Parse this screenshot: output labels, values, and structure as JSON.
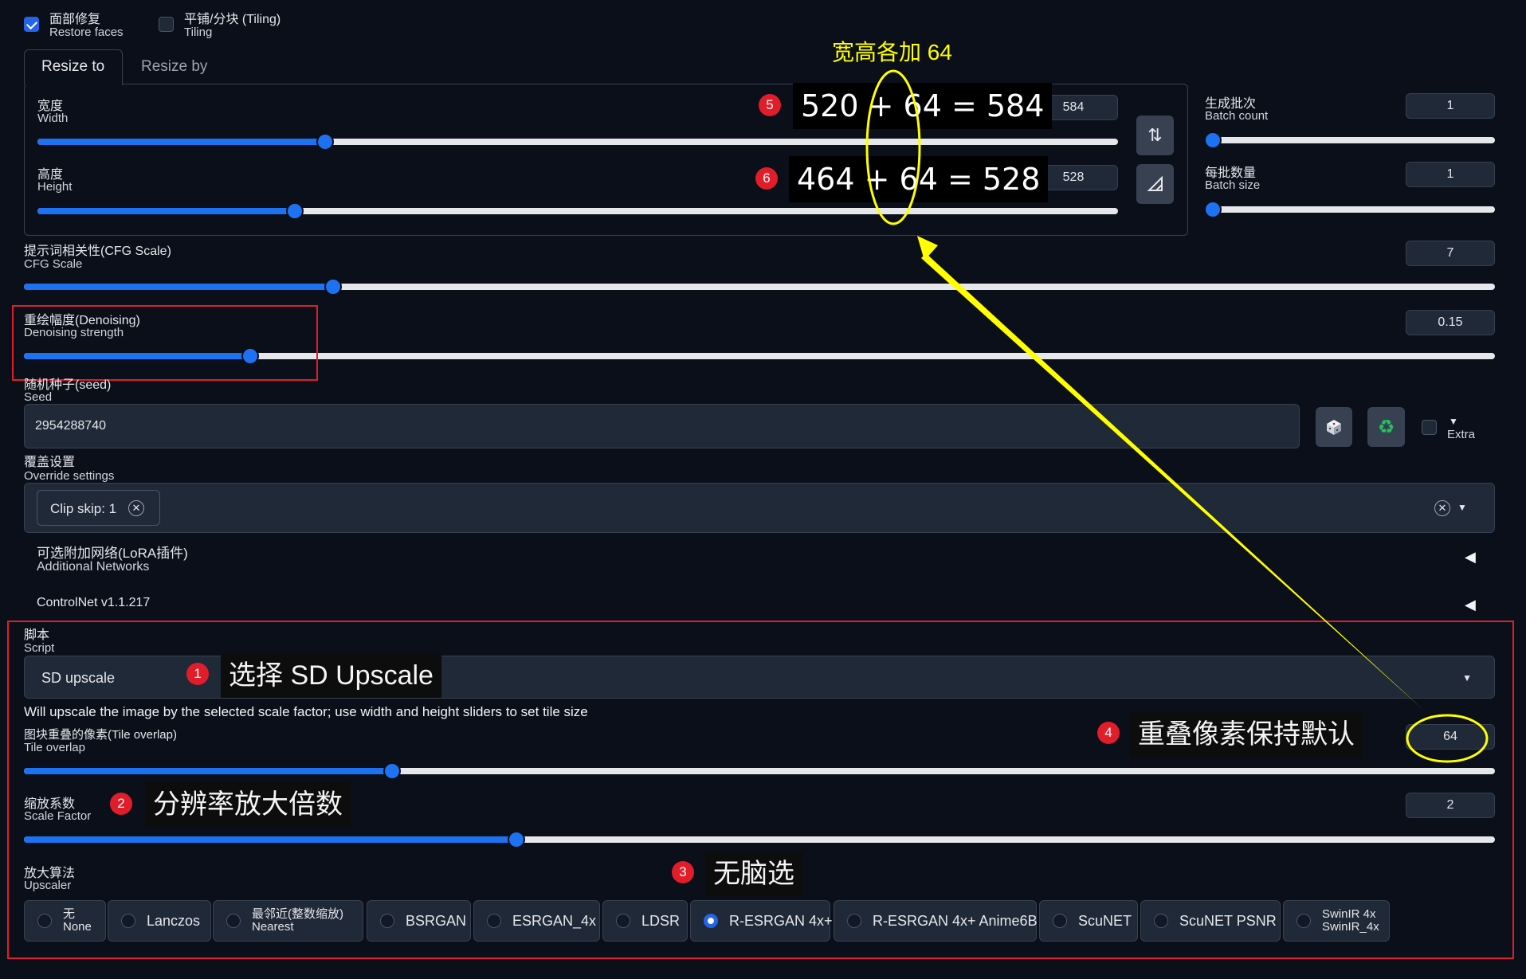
{
  "restore_faces": {
    "zh": "面部修复",
    "en": "Restore faces",
    "checked": true
  },
  "tiling": {
    "zh": "平铺/分块 (Tiling)",
    "en": "Tiling",
    "checked": false
  },
  "resize_tabs": {
    "active": "Resize to",
    "inactive": "Resize by"
  },
  "width": {
    "zh": "宽度",
    "en": "Width",
    "value": "584",
    "fraction": 0.266
  },
  "height": {
    "zh": "高度",
    "en": "Height",
    "value": "528",
    "fraction": 0.238
  },
  "swap_icon": "swap-arrows-icon",
  "ratio_icon": "aspect-ratio-icon",
  "batch_count": {
    "zh": "生成批次",
    "en": "Batch count",
    "value": "1",
    "fraction": 0.0
  },
  "batch_size": {
    "zh": "每批数量",
    "en": "Batch size",
    "value": "1",
    "fraction": 0.0
  },
  "cfg": {
    "zh": "提示词相关性(CFG Scale)",
    "en": "CFG Scale",
    "value": "7",
    "fraction": 0.21
  },
  "denoise": {
    "zh": "重绘幅度(Denoising)",
    "en": "Denoising strength",
    "value": "0.15",
    "fraction": 0.154
  },
  "seed": {
    "zh": "随机种子(seed)",
    "en": "Seed",
    "value": "2954288740",
    "extra_label": "Extra",
    "dice_icon": "dice-icon",
    "recycle_icon": "recycle-icon"
  },
  "override": {
    "zh": "覆盖设置",
    "en": "Override settings",
    "chip": "Clip skip: 1"
  },
  "networks": {
    "zh": "可选附加网络(LoRA插件)",
    "en": "Additional Networks"
  },
  "controlnet": {
    "label": "ControlNet v1.1.217"
  },
  "script": {
    "zh": "脚本",
    "en": "Script",
    "selected": "SD upscale",
    "description": "Will upscale the image by the selected scale factor; use width and height sliders to set tile size"
  },
  "tile_overlap": {
    "zh": "图块重叠的像素(Tile overlap)",
    "en": "Tile overlap",
    "value": "64",
    "fraction": 0.25
  },
  "scale_factor": {
    "zh": "缩放系数",
    "en": "Scale Factor",
    "value": "2",
    "fraction": 0.335
  },
  "upscaler": {
    "zh": "放大算法",
    "en": "Upscaler",
    "selected": "R-ESRGAN 4x+",
    "options": [
      {
        "label": "无",
        "sub": "None"
      },
      {
        "label": "Lanczos"
      },
      {
        "label": "最邻近(整数缩放)",
        "sub": "Nearest"
      },
      {
        "label": "BSRGAN"
      },
      {
        "label": "ESRGAN_4x"
      },
      {
        "label": "LDSR"
      },
      {
        "label": "R-ESRGAN 4x+"
      },
      {
        "label": "R-ESRGAN 4x+ Anime6B"
      },
      {
        "label": "ScuNET"
      },
      {
        "label": "ScuNET PSNR"
      },
      {
        "label": "SwinIR 4x",
        "sub": "SwinIR_4x"
      }
    ]
  },
  "annotations": {
    "title_note": "宽高各加 64",
    "eq_width": "520 + 64 = 584",
    "eq_height": "464 + 64 = 528",
    "step1": "选择 SD Upscale",
    "step2": "分辨率放大倍数",
    "step3": "无脑选",
    "step4": "重叠像素保持默认",
    "badge1": "1",
    "badge2": "2",
    "badge3": "3",
    "badge4": "4",
    "badge5": "5",
    "badge6": "6",
    "highlight_color": "#e11d2a",
    "arrow_color": "#ffff00"
  },
  "colors": {
    "accent": "#1d72f2",
    "background": "#0b0f19",
    "panel": "#1f2937"
  }
}
